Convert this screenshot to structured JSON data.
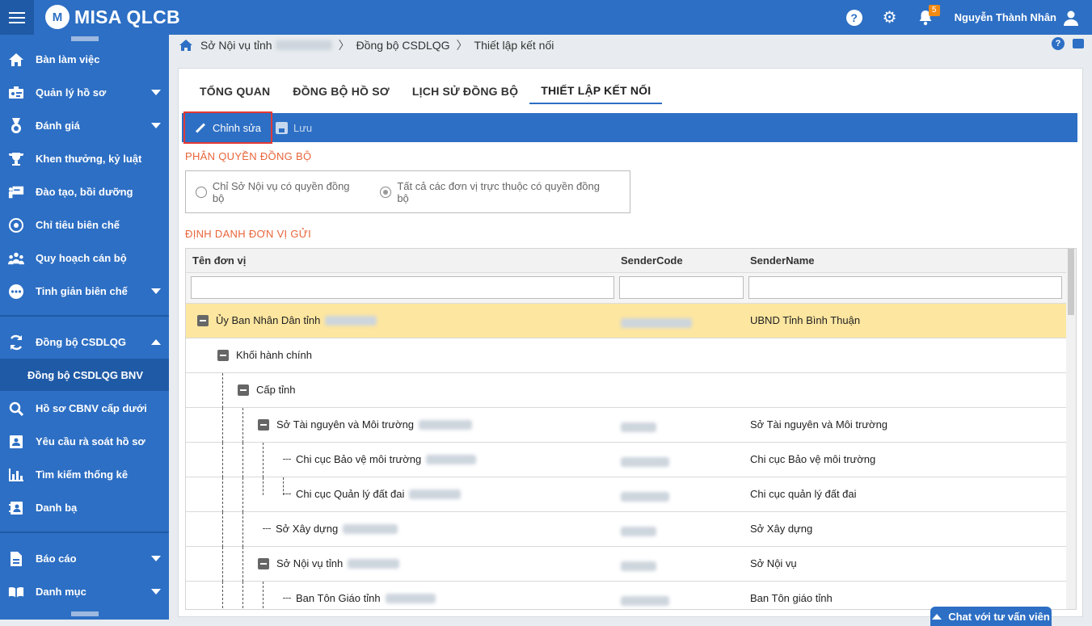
{
  "app": {
    "title": "MISA QLCB",
    "logo_letter": "M"
  },
  "topbar": {
    "notification_count": "5",
    "user_name": "Nguyễn Thành Nhân"
  },
  "sidebar": {
    "items": [
      {
        "label": "Bàn làm việc",
        "icon": "home-icon"
      },
      {
        "label": "Quản lý hồ sơ",
        "icon": "profile-icon"
      },
      {
        "label": "Đánh giá",
        "icon": "medal-icon"
      },
      {
        "label": "Khen thưởng, kỷ luật",
        "icon": "trophy-icon"
      },
      {
        "label": "Đào tạo, bồi dưỡng",
        "icon": "training-icon"
      },
      {
        "label": "Chỉ tiêu biên chế",
        "icon": "target-icon"
      },
      {
        "label": "Quy hoạch cán bộ",
        "icon": "team-icon"
      },
      {
        "label": "Tinh giản biên chế",
        "icon": "more-icon"
      },
      {
        "label": "Đồng bộ CSDLQG",
        "icon": "sync-icon"
      },
      {
        "label": "Đồng bộ CSDLQG BNV"
      },
      {
        "label": "Hồ sơ CBNV cấp dưới",
        "icon": "search-icon"
      },
      {
        "label": "Yêu cầu rà soát hồ sơ",
        "icon": "review-icon"
      },
      {
        "label": "Tìm kiếm thống kê",
        "icon": "stats-icon"
      },
      {
        "label": "Danh bạ",
        "icon": "contacts-icon"
      },
      {
        "label": "Báo cáo",
        "icon": "report-icon"
      },
      {
        "label": "Danh mục",
        "icon": "catalog-icon"
      }
    ]
  },
  "breadcrumb": {
    "root": "Sở Nội vụ tỉnh",
    "mid": "Đồng bộ CSDLQG",
    "current": "Thiết lập kết nối"
  },
  "tabs": [
    {
      "label": "TỔNG QUAN"
    },
    {
      "label": "ĐỒNG BỘ HỒ SƠ"
    },
    {
      "label": "LỊCH SỬ ĐỒNG BỘ"
    },
    {
      "label": "THIẾT LẬP KẾT NỐI"
    }
  ],
  "toolbar": {
    "edit_label": "Chỉnh sửa",
    "save_label": "Lưu"
  },
  "permission": {
    "title": "PHÂN QUYỀN ĐỒNG BỘ",
    "option1": "Chỉ Sở Nội vụ có quyền đồng bộ",
    "option2": "Tất cả các đơn vị trực thuộc có quyền đồng bộ"
  },
  "identity": {
    "title": "ĐỊNH DANH ĐƠN VỊ GỬI",
    "columns": {
      "name": "Tên đơn vị",
      "code": "SenderCode",
      "sender": "SenderName"
    },
    "rows": [
      {
        "name": "Ủy Ban Nhân Dân tỉnh",
        "sender_name": "UBND Tỉnh Bình Thuận"
      },
      {
        "name": "Khối hành chính",
        "sender_name": ""
      },
      {
        "name": "Cấp tỉnh",
        "sender_name": ""
      },
      {
        "name": "Sở Tài nguyên và Môi trường",
        "sender_name": "Sở Tài nguyên và Môi trường"
      },
      {
        "name": "Chi cục Bảo vệ môi trường",
        "sender_name": "Chi cục Bảo vệ môi trường"
      },
      {
        "name": "Chi cục Quản lý đất đai",
        "sender_name": "Chi cục quản lý đất đai"
      },
      {
        "name": "Sở Xây dựng",
        "sender_name": "Sở Xây dựng"
      },
      {
        "name": "Sở Nội vụ tỉnh",
        "sender_name": "Sở Nội vụ"
      },
      {
        "name": "Ban Tôn Giáo tỉnh",
        "sender_name": "Ban Tôn giáo tỉnh"
      }
    ]
  },
  "chat": {
    "label": "Chat với tư vấn viên"
  }
}
